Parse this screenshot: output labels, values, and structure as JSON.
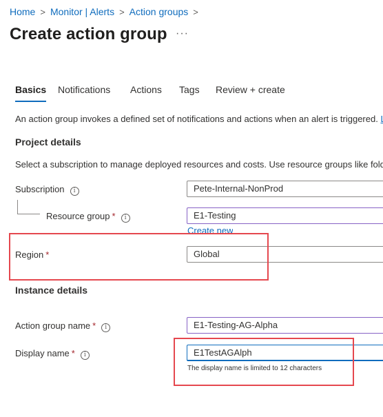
{
  "breadcrumb": {
    "items": [
      "Home",
      "Monitor | Alerts",
      "Action groups"
    ]
  },
  "page": {
    "title": "Create action group",
    "more_label": "···"
  },
  "tabs": [
    "Basics",
    "Notifications",
    "Actions",
    "Tags",
    "Review + create"
  ],
  "intro": {
    "text": "An action group invokes a defined set of notifications and actions when an alert is triggered.",
    "link_fragment": "L"
  },
  "project": {
    "heading": "Project details",
    "description": "Select a subscription to manage deployed resources and costs. Use resource groups like folde",
    "subscription": {
      "label": "Subscription",
      "value": "Pete-Internal-NonProd"
    },
    "resource_group": {
      "label": "Resource group",
      "value": "E1-Testing",
      "create_new": "Create new"
    },
    "region": {
      "label": "Region",
      "value": "Global"
    }
  },
  "instance": {
    "heading": "Instance details",
    "action_group_name": {
      "label": "Action group name",
      "value": "E1-Testing-AG-Alpha"
    },
    "display_name": {
      "label": "Display name",
      "value": "E1TestAGAlph",
      "hint": "The display name is limited to 12 characters"
    }
  },
  "required_marker": "*",
  "info_glyph": "i",
  "colors": {
    "link": "#0f6cbd",
    "required": "#a4262c",
    "callout": "#e5474e",
    "field_active": "#8661c5"
  }
}
